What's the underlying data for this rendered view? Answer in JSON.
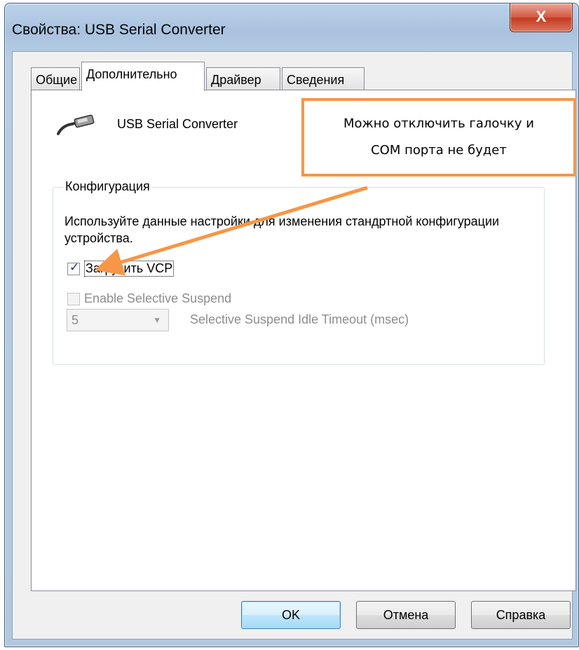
{
  "window": {
    "title": "Свойства: USB Serial Converter",
    "close_label": "X"
  },
  "tabs": [
    {
      "label": "Общие",
      "active": false
    },
    {
      "label": "Дополнительно",
      "active": true
    },
    {
      "label": "Драйвер",
      "active": false
    },
    {
      "label": "Сведения",
      "active": false
    }
  ],
  "device": {
    "name": "USB Serial Converter",
    "icon": "usb-plug-icon"
  },
  "config_group": {
    "title": "Конфигурация",
    "description": "Используйте данные настройки для изменения стандртной конфигурации устройства.",
    "load_vcp": {
      "label": "Загрузить VCP",
      "checked": true,
      "enabled": true
    },
    "selective_suspend": {
      "label": "Enable Selective Suspend",
      "checked": false,
      "enabled": false
    },
    "timeout": {
      "value": "5",
      "label": "Selective Suspend Idle Timeout (msec)",
      "enabled": false
    }
  },
  "buttons": {
    "ok": "OK",
    "cancel": "Отмена",
    "help": "Справка"
  },
  "annotation": {
    "line1": "Можно отключить галочку и",
    "line2": "COM порта не будет",
    "color": "#f79646"
  }
}
